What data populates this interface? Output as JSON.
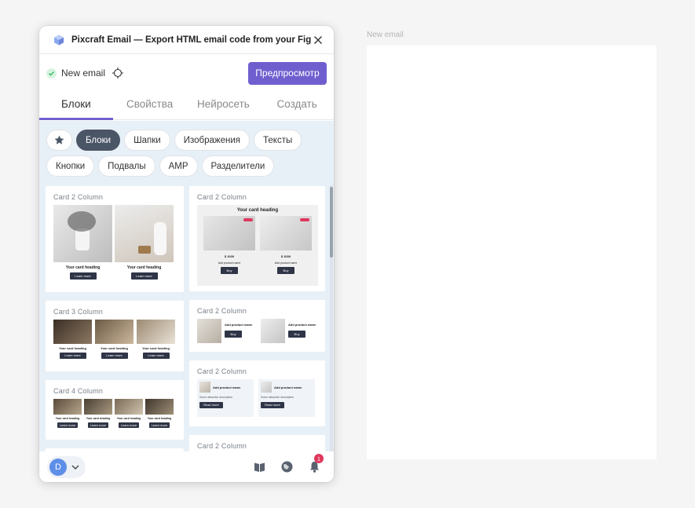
{
  "canvas": {
    "frame_label": "New email"
  },
  "plugin": {
    "title": "Pixcraft Email — Export HTML email code from your Figma...",
    "email_name": "New email",
    "preview_label": "Предпросмотр",
    "tabs": [
      {
        "label": "Блоки",
        "active": true
      },
      {
        "label": "Свойства",
        "active": false
      },
      {
        "label": "Нейросеть",
        "active": false
      },
      {
        "label": "Создать",
        "active": false
      }
    ],
    "chips": [
      {
        "label": "Блоки",
        "active": true
      },
      {
        "label": "Шапки"
      },
      {
        "label": "Изображения"
      },
      {
        "label": "Тексты"
      },
      {
        "label": "Кнопки"
      },
      {
        "label": "Подвалы"
      },
      {
        "label": "AMP"
      },
      {
        "label": "Разделители"
      }
    ],
    "cards_left": [
      {
        "title": "Card 2 Column",
        "heading": "Your card heading",
        "button": "Learn more"
      },
      {
        "title": "Card 3 Column",
        "heading": "Your card heading",
        "button": "Learn more"
      },
      {
        "title": "Card 4 Column",
        "heading": "Your card heading",
        "button": "Learn more"
      }
    ],
    "cards_right": [
      {
        "title": "Card 2 Column",
        "heading": "Your card heading",
        "price1": "$ 1000",
        "price2": "$ 1000",
        "product": "Add product name",
        "button": "Buy"
      },
      {
        "title": "Card 2 Column",
        "product": "Add product name",
        "button": "Buy"
      },
      {
        "title": "Card 2 Column",
        "product": "Add product name",
        "desc": "Some attractive description",
        "button": "Read more"
      },
      {
        "title": "Card 2 Column"
      }
    ],
    "user_initial": "D",
    "notification_count": "1"
  },
  "colors": {
    "accent": "#6f5fce",
    "chip_active": "#4a5566",
    "panel_bg": "#e8f0f7",
    "badge": "#e0375d"
  },
  "icons": [
    "app-cube-icon",
    "close-icon",
    "check-icon",
    "target-icon",
    "star-icon",
    "chevron-down-icon",
    "book-icon",
    "globe-icon",
    "bell-icon"
  ]
}
